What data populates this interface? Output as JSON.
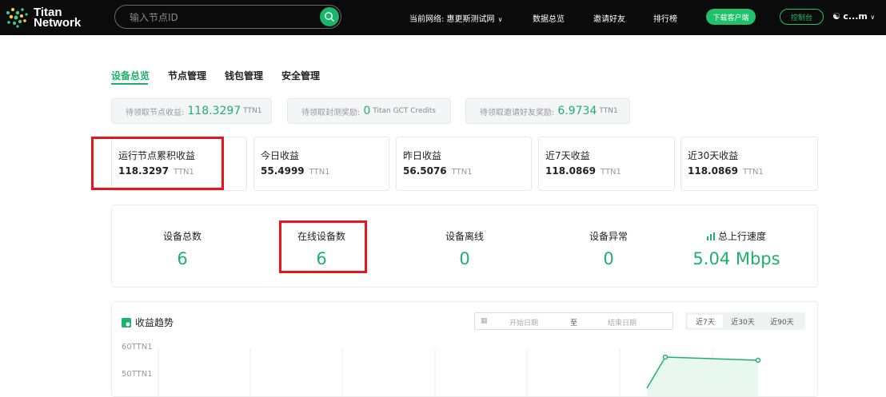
{
  "header": {
    "logo_line1": "Titan",
    "logo_line2": "Network",
    "search_placeholder": "输入节点ID",
    "network_label": "当前网络: 惠更斯测试网",
    "nav_stats": "数据总览",
    "nav_invite": "邀请好友",
    "nav_rank": "排行榜",
    "download_btn": "下载客户端",
    "console_btn": "控制台",
    "user_name": "c...m"
  },
  "tabs": [
    {
      "label": "设备总览",
      "active": true
    },
    {
      "label": "节点管理",
      "active": false
    },
    {
      "label": "钱包管理",
      "active": false
    },
    {
      "label": "安全管理",
      "active": false
    }
  ],
  "rewards": [
    {
      "label": "待领取节点收益:",
      "value": "118.3297",
      "unit": "TTN1"
    },
    {
      "label": "待领取封测奖励:",
      "value": "0",
      "unit": "Titan GCT Credits"
    },
    {
      "label": "待领取邀请好友奖励:",
      "value": "6.9734",
      "unit": "TTN1"
    }
  ],
  "earnings": [
    {
      "label": "运行节点累积收益",
      "value": "118.3297",
      "unit": "TTN1"
    },
    {
      "label": "今日收益",
      "value": "55.4999",
      "unit": "TTN1"
    },
    {
      "label": "昨日收益",
      "value": "56.5076",
      "unit": "TTN1"
    },
    {
      "label": "近7天收益",
      "value": "118.0869",
      "unit": "TTN1"
    },
    {
      "label": "近30天收益",
      "value": "118.0869",
      "unit": "TTN1"
    }
  ],
  "devices": [
    {
      "label": "设备总数",
      "value": "6"
    },
    {
      "label": "在线设备数",
      "value": "6"
    },
    {
      "label": "设备离线",
      "value": "0"
    },
    {
      "label": "设备异常",
      "value": "0"
    },
    {
      "label": "总上行速度",
      "value": "5.04 Mbps"
    }
  ],
  "trend": {
    "title": "收益趋势",
    "start_placeholder": "开始日期",
    "to": "至",
    "end_placeholder": "结束日期",
    "ranges": [
      {
        "label": "近7天",
        "active": true
      },
      {
        "label": "近30天",
        "active": false
      },
      {
        "label": "近90天",
        "active": false
      }
    ],
    "y_ticks": [
      "60TTN1",
      "50TTN1"
    ]
  },
  "colors": {
    "accent": "#1fb16b",
    "highlight": "#e8161b",
    "header_bg": "#0b0b0b"
  }
}
